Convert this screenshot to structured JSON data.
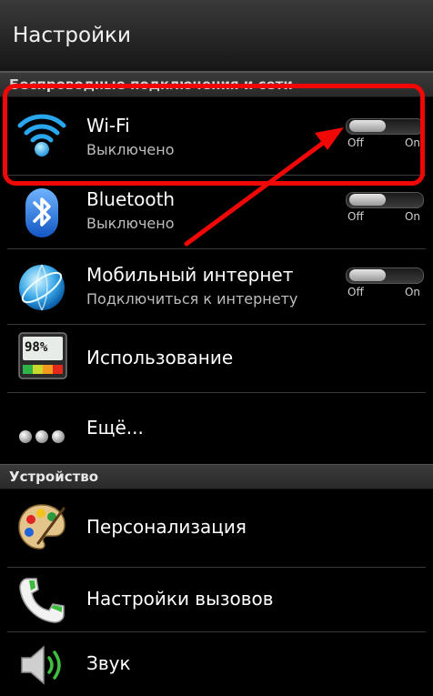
{
  "header": {
    "title": "Настройки"
  },
  "sections": {
    "wireless": "Беспроводные подключения и сети",
    "device": "Устройство"
  },
  "rows": {
    "wifi": {
      "title": "Wi-Fi",
      "subtitle": "Выключено",
      "toggle_off": "Off",
      "toggle_on": "On",
      "state": "off"
    },
    "bluetooth": {
      "title": "Bluetooth",
      "subtitle": "Выключено",
      "toggle_off": "Off",
      "toggle_on": "On",
      "state": "off"
    },
    "mobile": {
      "title": "Мобильный интернет",
      "subtitle": "Подключиться к интернету",
      "toggle_off": "Off",
      "toggle_on": "On",
      "state": "off"
    },
    "usage": {
      "title": "Использование",
      "meter_value": "98%"
    },
    "more": {
      "title": "Ещё..."
    },
    "personalize": {
      "title": "Персонализация"
    },
    "calls": {
      "title": "Настройки вызовов"
    },
    "sound": {
      "title": "Звук"
    }
  },
  "annotation": {
    "color": "#f00806"
  }
}
